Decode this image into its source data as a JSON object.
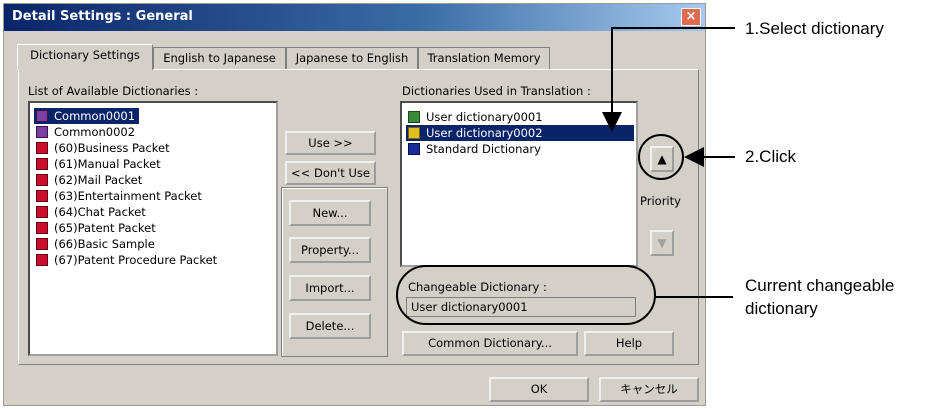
{
  "window": {
    "title": "Detail Settings : General",
    "close_glyph": "×"
  },
  "tabs": [
    {
      "label": "Dictionary Settings"
    },
    {
      "label": "English to Japanese"
    },
    {
      "label": "Japanese to English"
    },
    {
      "label": "Translation Memory"
    }
  ],
  "available": {
    "label": "List of Available Dictionaries :",
    "items": [
      {
        "label": "Common0001",
        "icon": "dict-special-icon"
      },
      {
        "label": "Common0002",
        "icon": "dict-special-icon"
      },
      {
        "label": "(60)Business Packet",
        "icon": "red-book-icon"
      },
      {
        "label": "(61)Manual Packet",
        "icon": "red-book-icon"
      },
      {
        "label": "(62)Mail Packet",
        "icon": "red-book-icon"
      },
      {
        "label": "(63)Entertainment Packet",
        "icon": "red-book-icon"
      },
      {
        "label": "(64)Chat Packet",
        "icon": "red-book-icon"
      },
      {
        "label": "(65)Patent Packet",
        "icon": "red-book-icon"
      },
      {
        "label": "(66)Basic Sample",
        "icon": "red-book-icon"
      },
      {
        "label": "(67)Patent Procedure Packet",
        "icon": "red-book-icon"
      }
    ]
  },
  "buttons": {
    "use": "Use >>",
    "dont_use": "<< Don't Use",
    "new": "New...",
    "property": "Property...",
    "import": "Import...",
    "delete": "Delete...",
    "common_dictionary": "Common Dictionary...",
    "help": "Help",
    "ok": "OK",
    "cancel": "キャンセル"
  },
  "used": {
    "label": "Dictionaries Used in Translation :",
    "items": [
      {
        "label": "User dictionary0001",
        "icon": "user-dict-edit-icon"
      },
      {
        "label": "User dictionary0002",
        "icon": "user-dict-icon"
      },
      {
        "label": "Standard Dictionary",
        "icon": "blue-book-icon"
      }
    ]
  },
  "priority": {
    "label": "Priority"
  },
  "changeable": {
    "label": "Changeable Dictionary :",
    "value": "User dictionary0001"
  },
  "annotations": {
    "select_dictionary": "1.Select dictionary",
    "click": "2.Click",
    "current_changeable_line1": "Current changeable",
    "current_changeable_line2": "dictionary"
  }
}
